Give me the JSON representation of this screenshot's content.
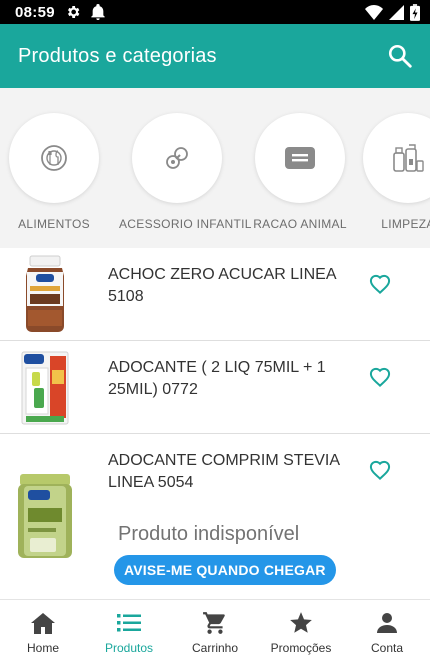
{
  "status_bar": {
    "time": "08:59"
  },
  "app_bar": {
    "title": "Produtos e categorias"
  },
  "categories": [
    {
      "label": "ALIMENTOS",
      "icon": "food-plate-icon"
    },
    {
      "label": "ACESSORIO INFANTIL",
      "icon": "pacifier-icon"
    },
    {
      "label": "RACAO ANIMAL",
      "icon": "pet-food-icon"
    },
    {
      "label": "LIMPEZA",
      "icon": "cleaning-products-icon"
    }
  ],
  "products": [
    {
      "name": "ACHOC ZERO ACUCAR LINEA 5108",
      "favorite": false
    },
    {
      "name": "ADOCANTE ( 2 LIQ 75MIL + 1 25MIL) 0772",
      "favorite": false
    },
    {
      "name": "ADOCANTE COMPRIM STEVIA LINEA 5054",
      "favorite": false,
      "unavailable_text": "Produto indisponível",
      "notify_label": "AVISE-ME QUANDO CHEGAR"
    }
  ],
  "bottom_nav": [
    {
      "label": "Home",
      "icon": "home-icon",
      "active": false
    },
    {
      "label": "Produtos",
      "icon": "list-icon",
      "active": true
    },
    {
      "label": "Carrinho",
      "icon": "cart-icon",
      "active": false
    },
    {
      "label": "Promoções",
      "icon": "star-icon",
      "active": false
    },
    {
      "label": "Conta",
      "icon": "person-icon",
      "active": false
    }
  ],
  "colors": {
    "primary": "#1aa79c",
    "accent_button": "#2496e8",
    "status_bar": "#000000"
  }
}
